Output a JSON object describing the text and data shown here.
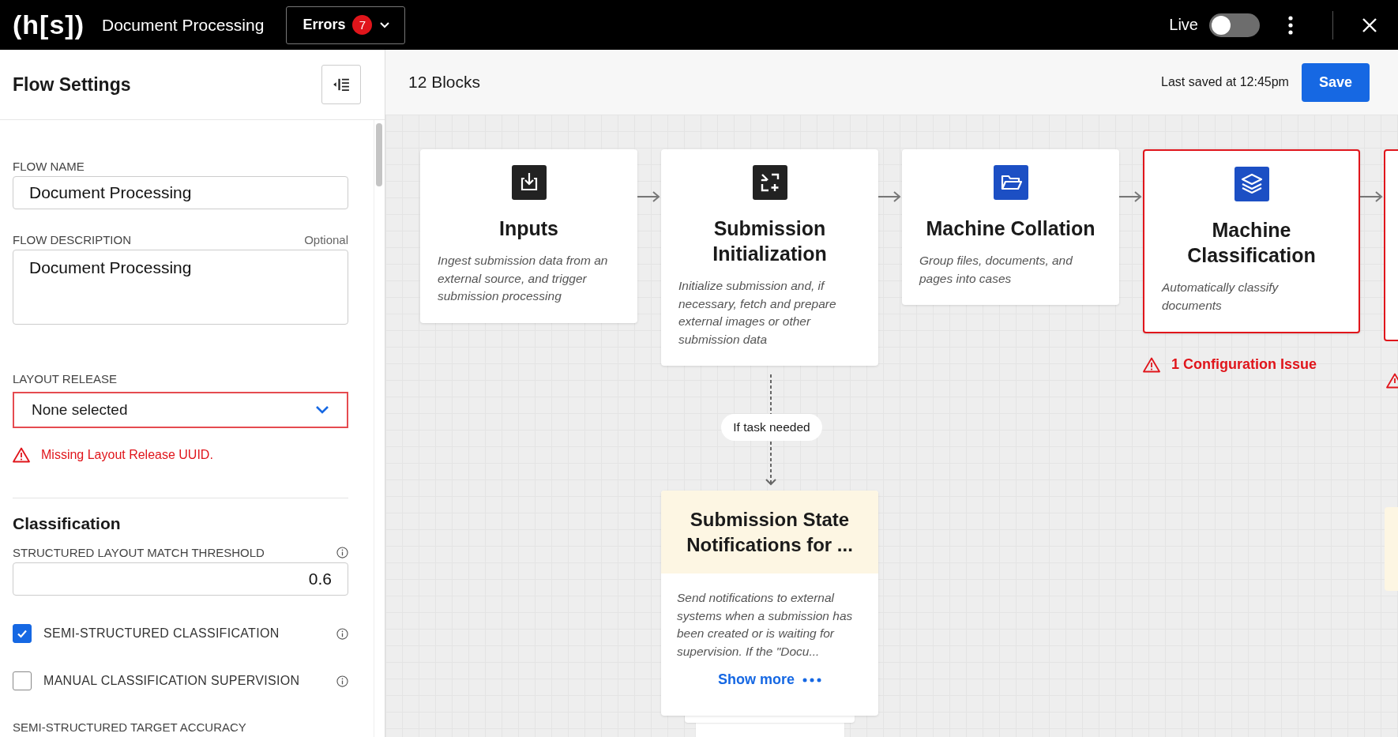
{
  "app": {
    "logo": "(h[s])",
    "title": "Document Processing",
    "errors": {
      "label": "Errors",
      "count": "7"
    },
    "live": {
      "label": "Live",
      "on": false
    }
  },
  "sidebar": {
    "title": "Flow Settings",
    "flow_name": {
      "label": "FLOW NAME",
      "value": "Document Processing"
    },
    "flow_description": {
      "label": "FLOW DESCRIPTION",
      "hint": "Optional",
      "value": "Document Processing"
    },
    "layout_release": {
      "label": "LAYOUT RELEASE",
      "value": "None selected",
      "invalid": true,
      "error": "Missing Layout Release UUID."
    },
    "section": "Classification",
    "threshold": {
      "label": "STRUCTURED LAYOUT MATCH THRESHOLD",
      "value": "0.6"
    },
    "options": [
      {
        "label": "SEMI-STRUCTURED CLASSIFICATION",
        "checked": true
      },
      {
        "label": "MANUAL CLASSIFICATION SUPERVISION",
        "checked": false
      }
    ],
    "next_label": "SEMI-STRUCTURED TARGET ACCURACY"
  },
  "canvas": {
    "blocks": "12 Blocks",
    "last_saved": "Last saved at 12:45pm",
    "save": "Save",
    "nodes": [
      {
        "title": "Inputs",
        "description": "Ingest submission data from an external source, and trigger submission processing",
        "error": false
      },
      {
        "title": "Submission Initialization",
        "description": "Initialize submission and, if necessary, fetch and prepare external images or other submission data",
        "error": false
      },
      {
        "title": "Machine Collation",
        "description": "Group files, documents, and pages into cases",
        "error": false
      },
      {
        "title": "Machine Classification",
        "description": "Automatically classify documents",
        "error": true,
        "issue": "1 Configuration Issue"
      }
    ],
    "edge_nodes": [
      {
        "kind": "card",
        "error": true
      },
      {
        "kind": "note",
        "error": false
      }
    ],
    "branch": {
      "label": "If task needed"
    },
    "task_node": {
      "title": "Submission State Notifications for ...",
      "description": "Send notifications to external systems when a submission has been created or is waiting for supervision. If the \"Docu...",
      "show_more": "Show more"
    }
  }
}
